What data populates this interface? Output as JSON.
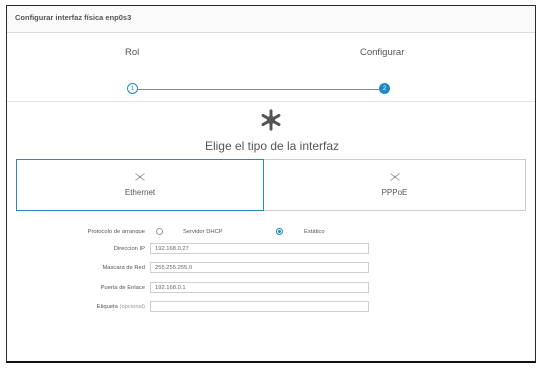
{
  "window": {
    "title": "Configurar interfaz física enp0s3"
  },
  "stepper": {
    "steps": [
      {
        "label": "Rol",
        "number": "1"
      },
      {
        "label": "Configurar",
        "number": "2"
      }
    ]
  },
  "heading": "Elige el tipo de la interfaz",
  "interface_types": [
    {
      "label": "Ethernet",
      "selected": true,
      "icon": "network-icon"
    },
    {
      "label": "PPPoE",
      "selected": false,
      "icon": "network-icon"
    }
  ],
  "form": {
    "boot_protocol": {
      "label": "Protocolo de arranque",
      "options": [
        {
          "label": "Servidor DHCP",
          "checked": false
        },
        {
          "label": "Estático",
          "checked": true
        }
      ]
    },
    "ip_address": {
      "label": "Direccion IP",
      "value": "192.168.0.27"
    },
    "netmask": {
      "label": "Mascara de Red",
      "value": "255.255.255.0"
    },
    "gateway": {
      "label": "Puerta de Enlace",
      "value": "192.168.0.1"
    },
    "tag": {
      "label": "Etiqueta",
      "optional": "(opcional)",
      "value": ""
    }
  },
  "colors": {
    "accent": "#1e88c8",
    "gear": "#555555"
  }
}
